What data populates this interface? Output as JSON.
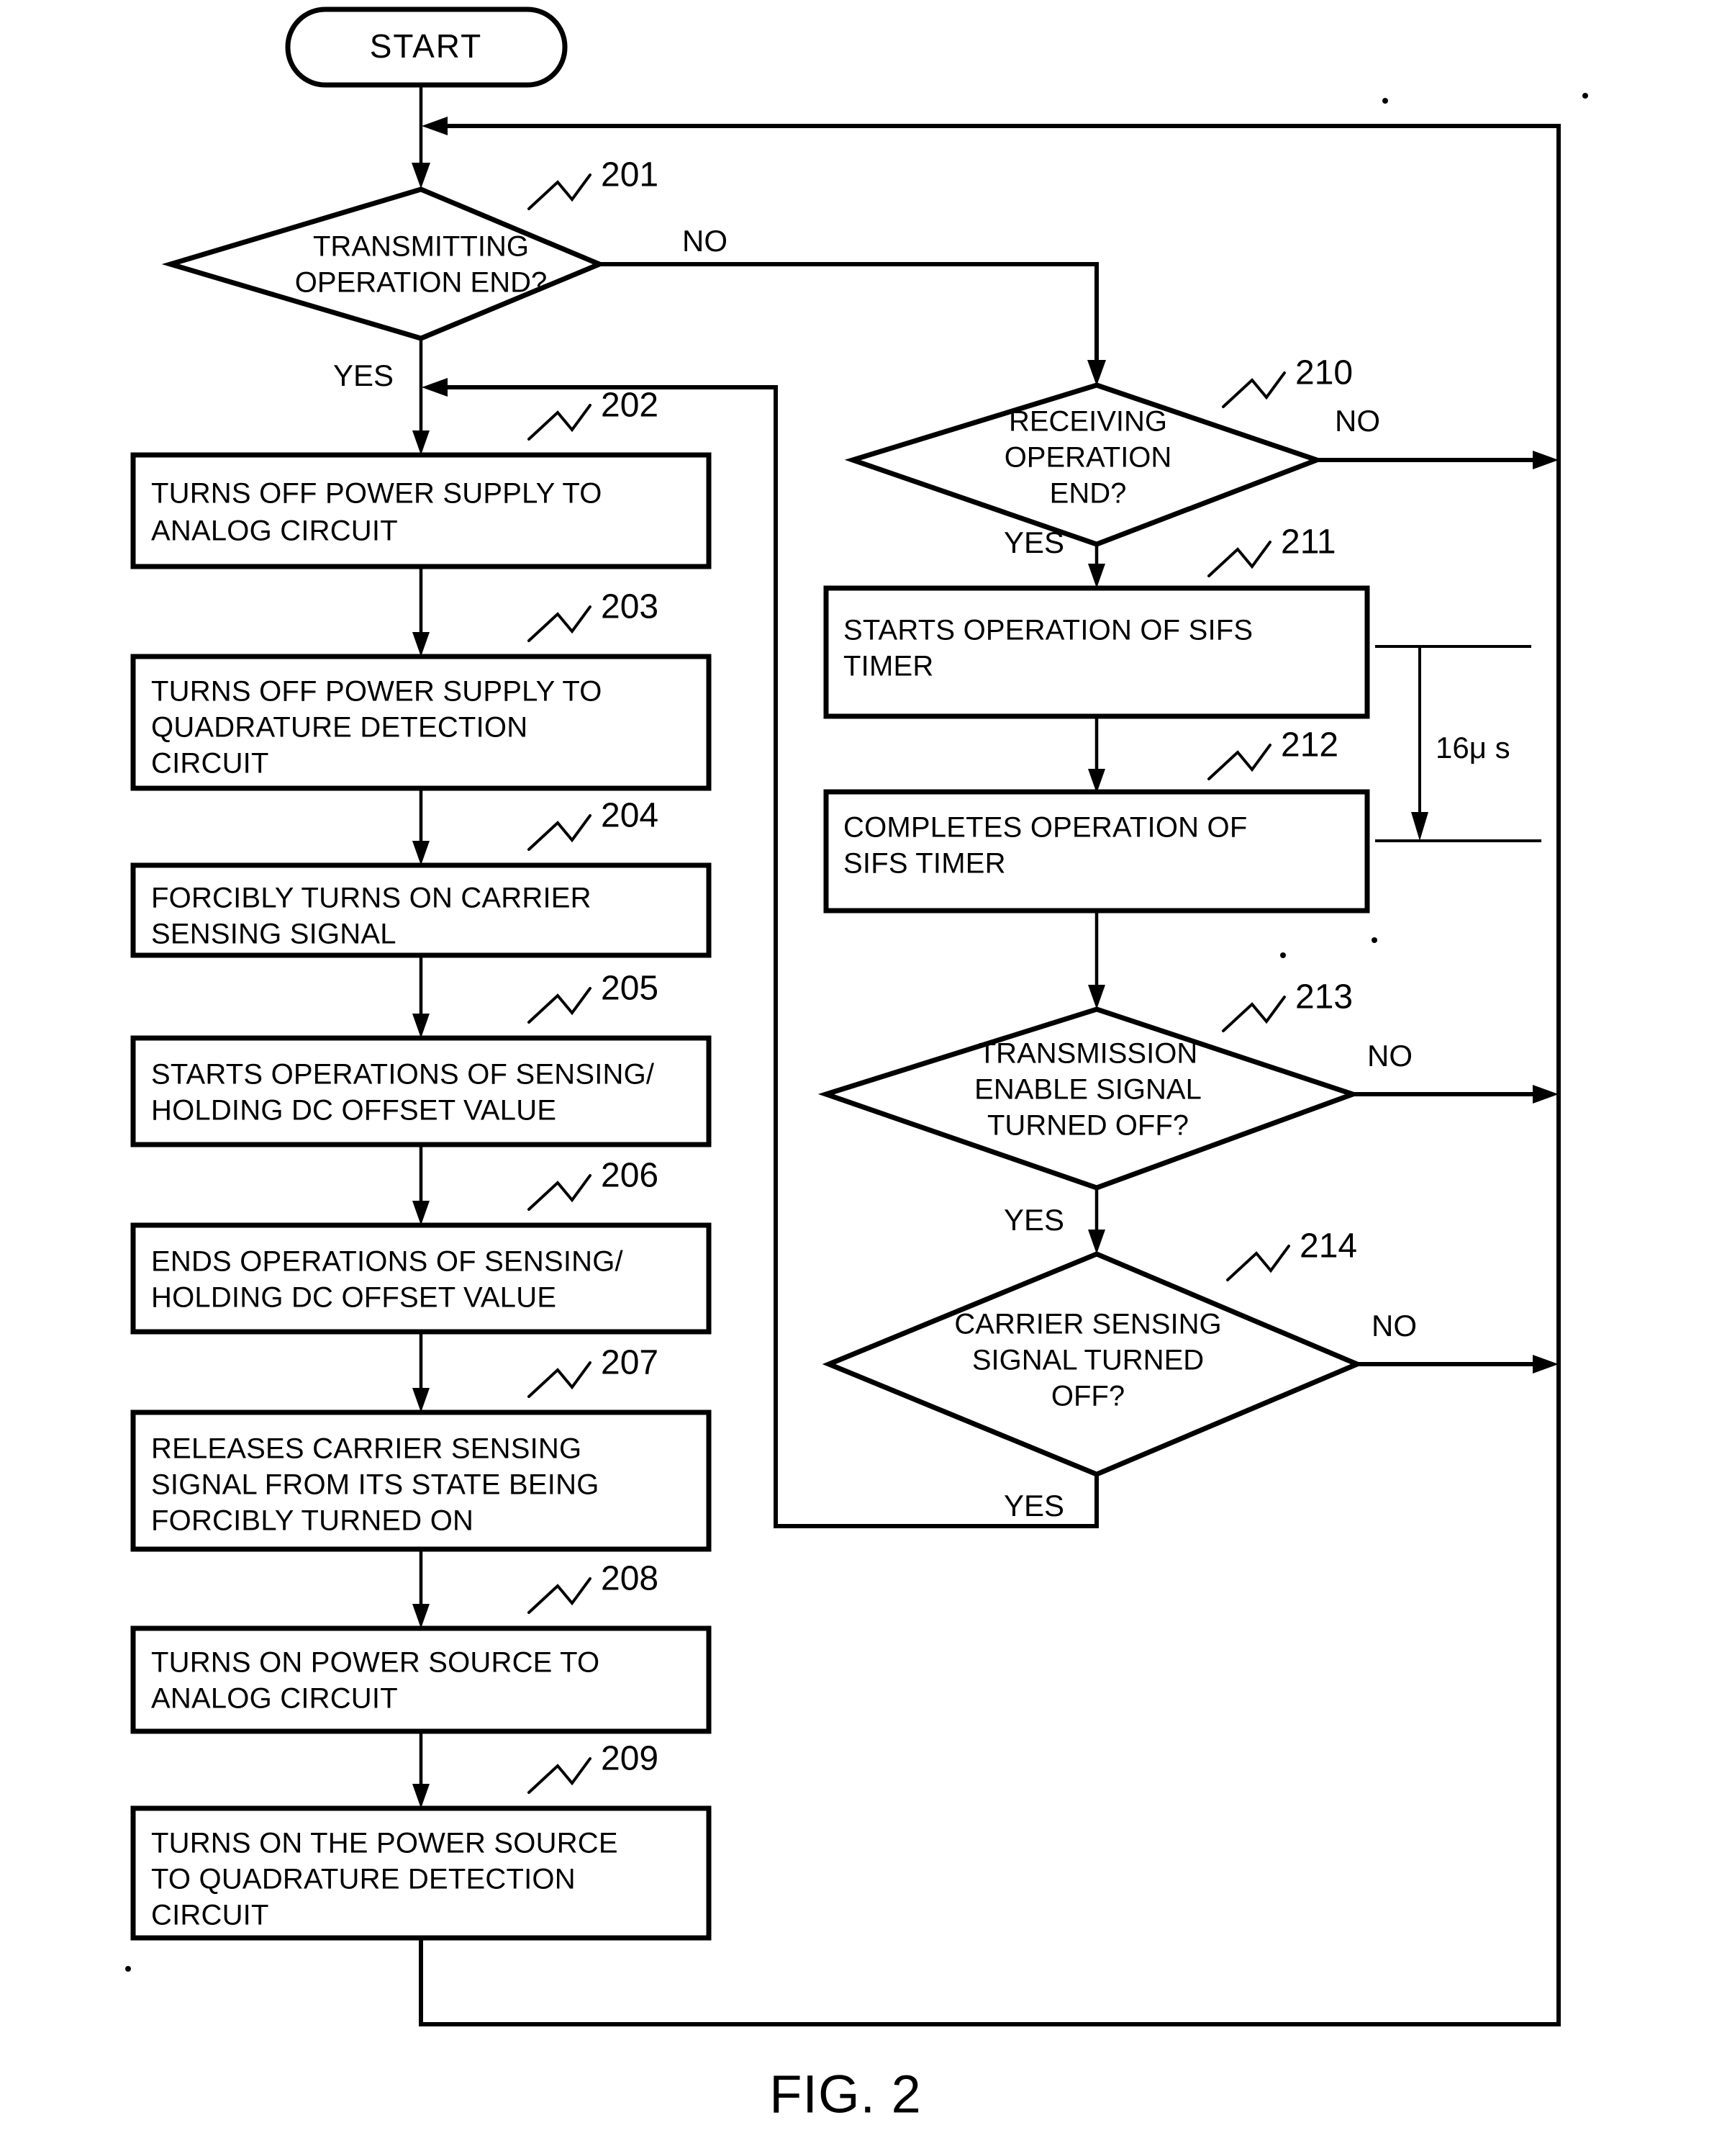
{
  "figure": {
    "caption": "FIG. 2",
    "title": "Flowchart of transmitting and receiving power control operation"
  },
  "terminator": {
    "start_label": "START"
  },
  "branch_labels": {
    "yes": "YES",
    "no": "NO"
  },
  "annotations": {
    "sifs_duration": "16μ s"
  },
  "nodes": [
    {
      "ref": "201",
      "type": "decision",
      "lines": [
        "TRANSMITTING",
        "OPERATION END?"
      ]
    },
    {
      "ref": "202",
      "type": "process",
      "lines": [
        "TURNS OFF POWER SUPPLY TO",
        "ANALOG CIRCUIT"
      ]
    },
    {
      "ref": "203",
      "type": "process",
      "lines": [
        "TURNS OFF POWER SUPPLY TO",
        "QUADRATURE DETECTION",
        "CIRCUIT"
      ]
    },
    {
      "ref": "204",
      "type": "process",
      "lines": [
        "FORCIBLY TURNS ON CARRIER",
        "SENSING SIGNAL"
      ]
    },
    {
      "ref": "205",
      "type": "process",
      "lines": [
        "STARTS OPERATIONS OF SENSING/",
        "HOLDING DC OFFSET VALUE"
      ]
    },
    {
      "ref": "206",
      "type": "process",
      "lines": [
        "ENDS OPERATIONS OF SENSING/",
        "HOLDING DC OFFSET VALUE"
      ]
    },
    {
      "ref": "207",
      "type": "process",
      "lines": [
        "RELEASES CARRIER SENSING",
        "SIGNAL FROM ITS STATE BEING",
        "FORCIBLY TURNED ON"
      ]
    },
    {
      "ref": "208",
      "type": "process",
      "lines": [
        "TURNS ON POWER SOURCE TO",
        "ANALOG CIRCUIT"
      ]
    },
    {
      "ref": "209",
      "type": "process",
      "lines": [
        "TURNS ON  THE POWER SOURCE",
        "TO QUADRATURE DETECTION",
        "CIRCUIT"
      ]
    },
    {
      "ref": "210",
      "type": "decision",
      "lines": [
        "RECEIVING",
        "OPERATION",
        "END?"
      ]
    },
    {
      "ref": "211",
      "type": "process",
      "lines": [
        "STARTS OPERATION OF SIFS",
        "TIMER"
      ]
    },
    {
      "ref": "212",
      "type": "process",
      "lines": [
        "COMPLETES OPERATION OF",
        "SIFS TIMER"
      ]
    },
    {
      "ref": "213",
      "type": "decision",
      "lines": [
        "TRANSMISSION",
        "ENABLE SIGNAL",
        "TURNED OFF?"
      ]
    },
    {
      "ref": "214",
      "type": "decision",
      "lines": [
        "CARRIER SENSING",
        "SIGNAL TURNED",
        "OFF?"
      ]
    }
  ],
  "colors": {
    "stroke": "#000000",
    "background": "#ffffff"
  }
}
